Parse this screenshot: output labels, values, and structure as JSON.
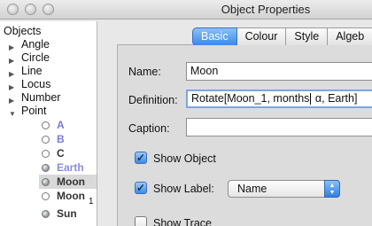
{
  "window": {
    "title": "Object Properties"
  },
  "tree": {
    "root_label": "Objects",
    "categories": [
      "Angle",
      "Circle",
      "Line",
      "Locus",
      "Number",
      "Point"
    ],
    "points": [
      {
        "label": "A",
        "color": "#7a7ae0",
        "style": "hollow",
        "subscript": ""
      },
      {
        "label": "B",
        "color": "#7a7ae0",
        "style": "hollow",
        "subscript": ""
      },
      {
        "label": "C",
        "color": "#333333",
        "style": "hollow",
        "subscript": ""
      },
      {
        "label": "Earth",
        "color": "#8a8ae6",
        "style": "filled",
        "subscript": ""
      },
      {
        "label": "Moon",
        "color": "#333333",
        "style": "filled",
        "subscript": "",
        "selected": true
      },
      {
        "label": "Moon",
        "color": "#333333",
        "style": "hollow",
        "subscript": "1"
      },
      {
        "label": "Sun",
        "color": "#333333",
        "style": "filled",
        "subscript": ""
      }
    ]
  },
  "tabs": [
    "Basic",
    "Colour",
    "Style",
    "Algeb"
  ],
  "active_tab": "Basic",
  "form": {
    "name_label": "Name:",
    "name_value": "Moon",
    "definition_label": "Definition:",
    "definition_before_caret": "Rotate[Moon_1, months",
    "definition_after_caret": " α, Earth]",
    "caption_label": "Caption:",
    "caption_value": "",
    "show_object_label": "Show Object",
    "show_object_checked": true,
    "show_label_label": "Show Label:",
    "show_label_checked": true,
    "label_mode": "Name",
    "show_trace_label": "Show Trace",
    "show_trace_checked": false
  }
}
